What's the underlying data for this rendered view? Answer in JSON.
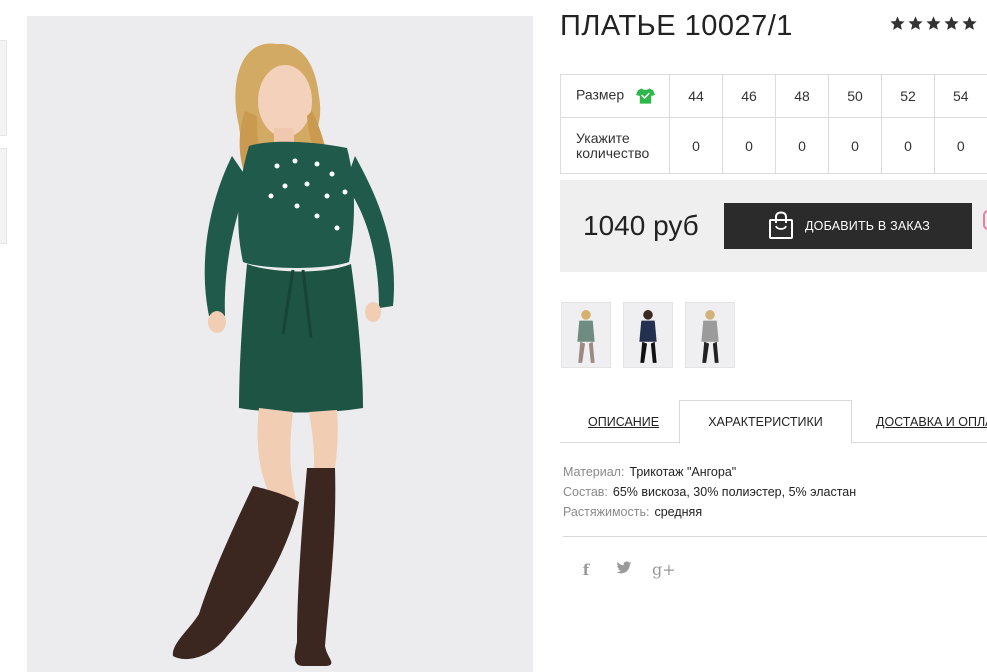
{
  "product": {
    "title": "ПЛАТЬЕ 10027/1",
    "rating": 5
  },
  "sizes": {
    "size_label": "Размер",
    "qty_label": "Укажите количество",
    "values": [
      "44",
      "46",
      "48",
      "50",
      "52",
      "54"
    ],
    "quantities": [
      "0",
      "0",
      "0",
      "0",
      "0",
      "0"
    ]
  },
  "price": {
    "amount": "1040 руб",
    "add_button": "ДОБАВИТЬ В ЗАКАЗ"
  },
  "thumbnails": [
    {
      "name": "thumb-green-dress"
    },
    {
      "name": "thumb-navy-dress"
    },
    {
      "name": "thumb-grey-dress"
    }
  ],
  "tabs": {
    "description": "ОПИСАНИЕ",
    "characteristics": "ХАРАКТЕРИСТИКИ",
    "delivery": "ДОСТАВКА И ОПЛАТА"
  },
  "characteristics": [
    {
      "key": "Материал:",
      "value": "Трикотаж \"Ангора\""
    },
    {
      "key": "Состав:",
      "value": "65% вискоза, 30% полиэстер, 5% эластан"
    },
    {
      "key": "Растяжимость:",
      "value": "средняя"
    }
  ],
  "social": {
    "facebook": "f",
    "twitter": "t",
    "googleplus": "g+"
  },
  "colors": {
    "button_bg": "#2b2b2b",
    "price_bg": "#efefef",
    "dress_green": "#1f5a4a",
    "boots_brown": "#3b2620",
    "tee_icon_green": "#2fb84a"
  }
}
